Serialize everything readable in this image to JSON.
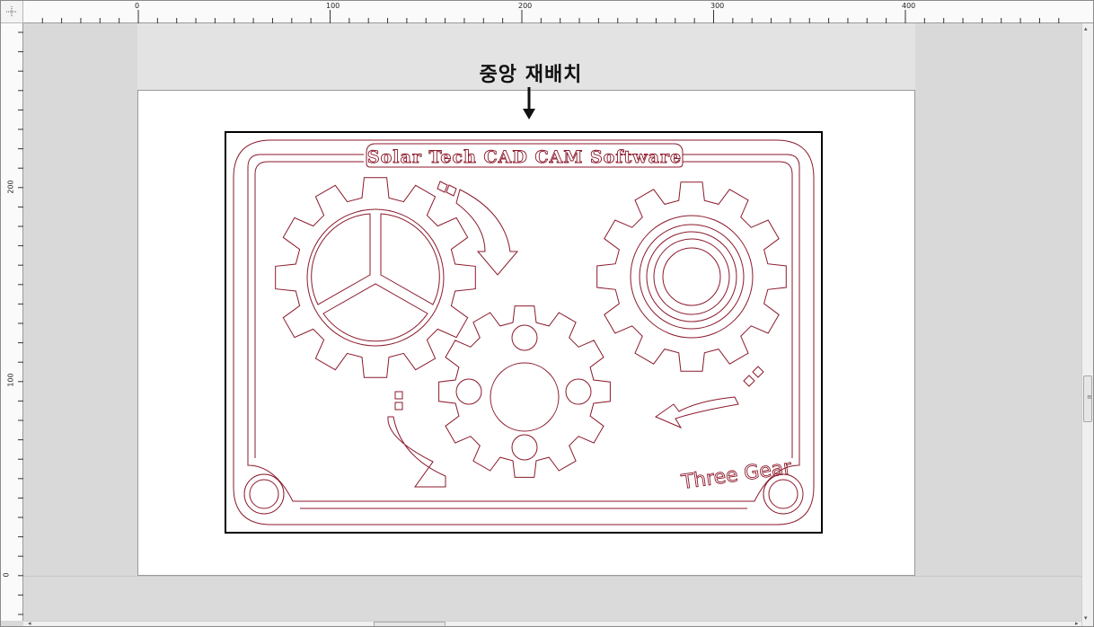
{
  "annotation": {
    "text": "중앙 재배치",
    "arrow": "down-arrow-icon"
  },
  "rulers": {
    "horizontal_labels": [
      "0",
      "100",
      "200",
      "300",
      "400"
    ],
    "vertical_labels": [
      "200",
      "100",
      "0"
    ]
  },
  "design": {
    "title_text": "Solar Tech CAD CAM Software",
    "caption_text": "Three Gear"
  },
  "colors": {
    "outline": "#8b1a2b",
    "border": "#000000",
    "background": "#d9d9d9",
    "paper": "#ffffff"
  }
}
